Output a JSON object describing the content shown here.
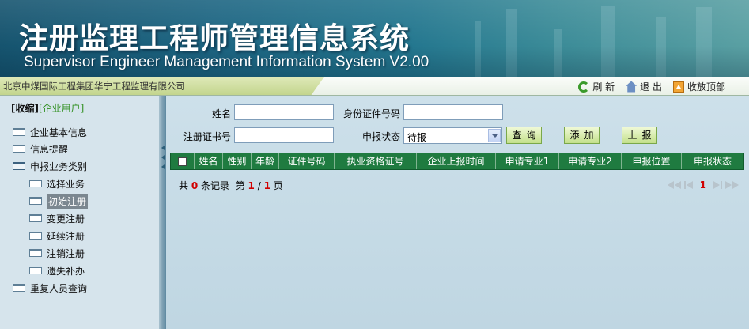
{
  "header": {
    "title_cn": "注册监理工程师管理信息系统",
    "title_en": "Supervisor Engineer Management Information System V2.00"
  },
  "bar": {
    "company": "北京中煤国际工程集团华宁工程监理有限公司",
    "links": [
      {
        "label": "刷 新",
        "icon": "refresh-icon"
      },
      {
        "label": "退 出",
        "icon": "home-icon"
      },
      {
        "label": "收放顶部",
        "icon": "collapse-top-icon"
      }
    ]
  },
  "sidebar": {
    "collapse": "[收缩]",
    "user_type": "[企业用户]",
    "items": [
      {
        "label": "企业基本信息",
        "level": 0
      },
      {
        "label": "信息提醒",
        "level": 0
      },
      {
        "label": "申报业务类别",
        "level": 0,
        "expanded": true
      },
      {
        "label": "选择业务",
        "level": 1
      },
      {
        "label": "初始注册",
        "level": 1,
        "active": true
      },
      {
        "label": "变更注册",
        "level": 1
      },
      {
        "label": "延续注册",
        "level": 1
      },
      {
        "label": "注销注册",
        "level": 1
      },
      {
        "label": "遗失补办",
        "level": 1
      },
      {
        "label": "重复人员查询",
        "level": 0
      }
    ]
  },
  "filters": {
    "name_label": "姓名",
    "name_value": "",
    "id_label": "身份证件号码",
    "id_value": "",
    "cert_label": "注册证书号",
    "cert_value": "",
    "status_label": "申报状态",
    "status_value": "待报"
  },
  "buttons": {
    "query": "查询",
    "add": "添加",
    "submit": "上报"
  },
  "grid": {
    "columns": [
      "姓名",
      "性别",
      "年龄",
      "证件号码",
      "执业资格证号",
      "企业上报时间",
      "申请专业1",
      "申请专业2",
      "申报位置",
      "申报状态"
    ],
    "rows": []
  },
  "summary": {
    "prefix": "共",
    "total": "0",
    "records_text": "条记录",
    "page_prefix": "第",
    "current_page": "1",
    "separator": "/",
    "total_pages": "1",
    "page_suffix": "页"
  },
  "pager": {
    "current": "1"
  },
  "colors": {
    "grid_header": "#1f7b40",
    "accent_green": "#2f8f1f",
    "header_blue": "#1d6683",
    "count_red": "#d10000"
  }
}
